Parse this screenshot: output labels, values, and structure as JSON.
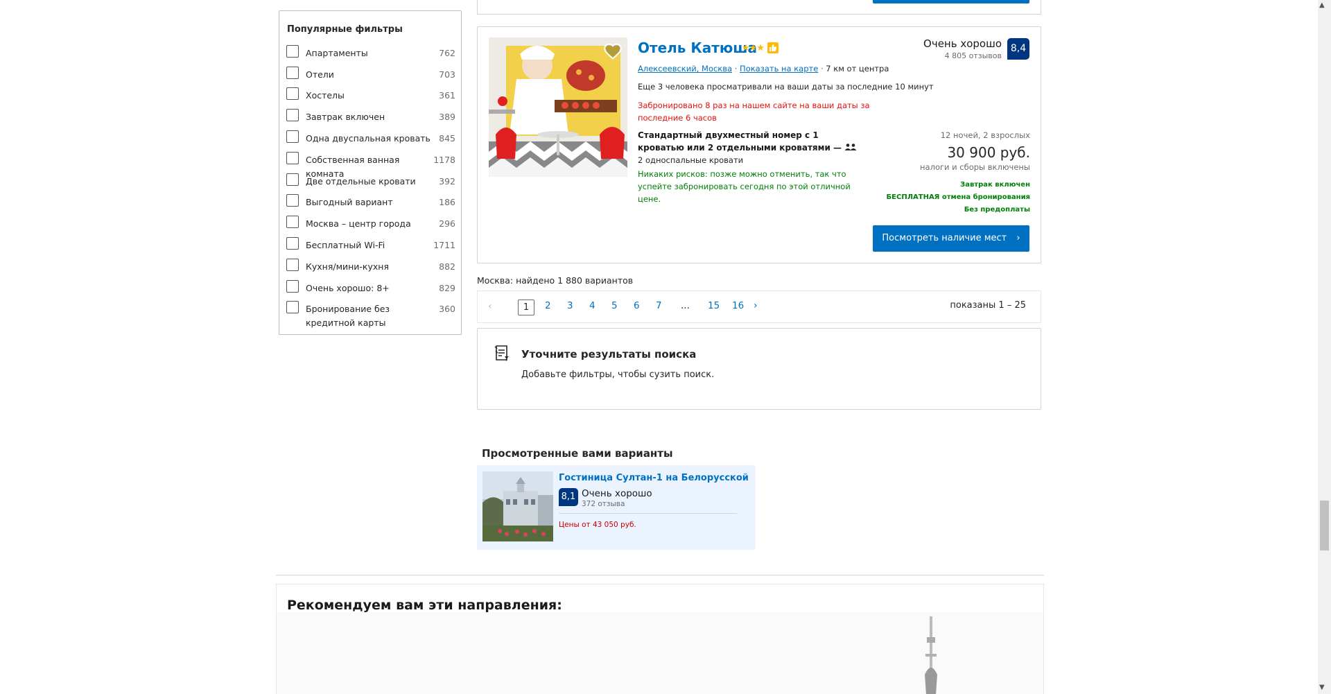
{
  "filters": {
    "title": "Популярные фильтры",
    "items": [
      {
        "label": "Апартаменты",
        "count": "762"
      },
      {
        "label": "Отели",
        "count": "703"
      },
      {
        "label": "Хостелы",
        "count": "361"
      },
      {
        "label": "Завтрак включен",
        "count": "389"
      },
      {
        "label": "Одна двуспальная кровать",
        "count": "845"
      },
      {
        "label": "Собственная ванная комната",
        "count": "1178"
      },
      {
        "label": "Две отдельные кровати",
        "count": "392"
      },
      {
        "label": "Выгодный вариант",
        "count": "186"
      },
      {
        "label": "Москва – центр города",
        "count": "296"
      },
      {
        "label": "Бесплатный Wi-Fi",
        "count": "1711"
      },
      {
        "label": "Кухня/мини-кухня",
        "count": "882"
      },
      {
        "label": "Очень хорошо: 8+",
        "count": "829"
      },
      {
        "label": "Бронирование без кредитной карты",
        "count": "360"
      }
    ]
  },
  "hotel": {
    "name": "Отель Катюша",
    "stars": "★★★",
    "district": "Алексеевский, Москва",
    "map_link": "Показать на карте",
    "distance": "7 км от центра",
    "viewing_now": "Еще 3 человека просматривали на ваши даты за последние 10 минут",
    "booked_recent": "Забронировано 8 раз на нашем сайте на ваши даты за последние 6 часов",
    "room_name": "Стандартный двухместный номер с 1 кроватью или 2 отдельными кроватями",
    "room_dash": "—",
    "beds": "2 односпальные кровати",
    "free_cancel_note": "Никаких рисков: позже можно отменить, так что успейте забронировать сегодня по этой отличной цене.",
    "score_word": "Очень хорошо",
    "score_reviews": "4 805 отзывов",
    "score": "8,4",
    "nights": "12 ночей, 2 взрослых",
    "price": "30 900 руб.",
    "taxes": "налоги и сборы включены",
    "perks": [
      "Завтрак включен",
      "БЕСПЛАТНАЯ отмена бронирования",
      "Без предоплаты"
    ],
    "button": "Посмотреть наличие мест"
  },
  "results": {
    "found": "Москва: найдено 1 880 вариантов",
    "current_page": "1",
    "pages": [
      "2",
      "3",
      "4",
      "5",
      "6",
      "7",
      "...",
      "15",
      "16"
    ],
    "shown": "показаны 1 – 25"
  },
  "refine": {
    "title": "Уточните результаты поиска",
    "subtitle": "Добавьте фильтры, чтобы сузить поиск."
  },
  "viewed": {
    "title": "Просмотренные вами варианты",
    "name": "Гостиница Султан-1 на Белорусской",
    "score": "8,1",
    "score_word": "Очень хорошо",
    "reviews": "372 отзыва",
    "price": "Цены от 43 050 руб."
  },
  "recommend": {
    "title": "Рекомендуем вам эти направления:"
  },
  "colors": {
    "brand_blue": "#0071c2",
    "dark_blue": "#003580",
    "green": "#008009",
    "red": "#e21111",
    "star": "#febb02"
  }
}
